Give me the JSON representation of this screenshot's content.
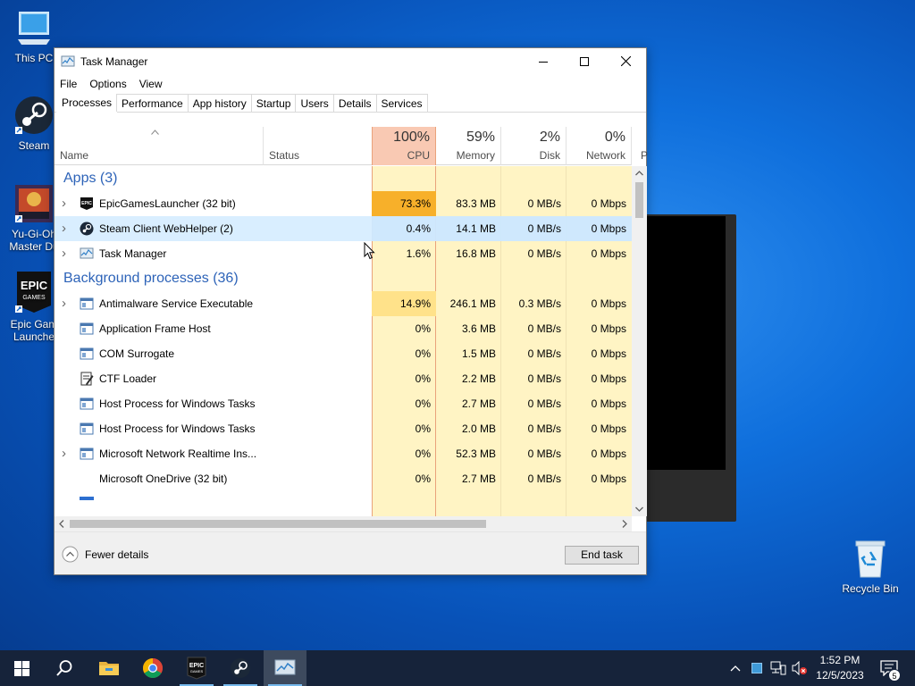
{
  "desktop": {
    "icons": [
      {
        "id": "this-pc",
        "label_lines": [
          "This PC"
        ]
      },
      {
        "id": "steam",
        "label_lines": [
          "Steam"
        ]
      },
      {
        "id": "yugioh",
        "label_lines": [
          "Yu-Gi-Oh",
          "Master Du"
        ]
      },
      {
        "id": "epic",
        "label_lines": [
          "Epic Gam",
          "Launche"
        ]
      },
      {
        "id": "recycle",
        "label_lines": [
          "Recycle Bin"
        ]
      }
    ]
  },
  "window": {
    "title": "Task Manager",
    "menu": [
      "File",
      "Options",
      "View"
    ],
    "tabs": [
      "Processes",
      "Performance",
      "App history",
      "Startup",
      "Users",
      "Details",
      "Services"
    ],
    "active_tab": "Processes",
    "columns": {
      "name": "Name",
      "status": "Status",
      "cpu": {
        "pct": "100%",
        "label": "CPU"
      },
      "memory": {
        "pct": "59%",
        "label": "Memory"
      },
      "disk": {
        "pct": "2%",
        "label": "Disk"
      },
      "network": {
        "pct": "0%",
        "label": "Network"
      },
      "power_partial": "P"
    },
    "groups": {
      "apps": "Apps (3)",
      "background": "Background processes (36)"
    },
    "rows": [
      {
        "group": "apps",
        "name": "EpicGamesLauncher (32 bit)",
        "icon": "epic-games-icon",
        "expandable": true,
        "cpu": "73.3%",
        "memory": "83.3 MB",
        "disk": "0 MB/s",
        "network": "0 Mbps",
        "cpu_heat": "high"
      },
      {
        "group": "apps",
        "name": "Steam Client WebHelper (2)",
        "icon": "steam-icon",
        "expandable": true,
        "cpu": "0.4%",
        "memory": "14.1 MB",
        "disk": "0 MB/s",
        "network": "0 Mbps",
        "selected": true
      },
      {
        "group": "apps",
        "name": "Task Manager",
        "icon": "task-manager-icon",
        "expandable": true,
        "cpu": "1.6%",
        "memory": "16.8 MB",
        "disk": "0 MB/s",
        "network": "0 Mbps"
      },
      {
        "group": "background",
        "name": "Antimalware Service Executable",
        "icon": "service-window-icon",
        "expandable": true,
        "cpu": "14.9%",
        "memory": "246.1 MB",
        "disk": "0.3 MB/s",
        "network": "0 Mbps",
        "cpu_heat": "med"
      },
      {
        "group": "background",
        "name": "Application Frame Host",
        "icon": "service-window-icon",
        "expandable": false,
        "cpu": "0%",
        "memory": "3.6 MB",
        "disk": "0 MB/s",
        "network": "0 Mbps"
      },
      {
        "group": "background",
        "name": "COM Surrogate",
        "icon": "service-window-icon",
        "expandable": false,
        "cpu": "0%",
        "memory": "1.5 MB",
        "disk": "0 MB/s",
        "network": "0 Mbps"
      },
      {
        "group": "background",
        "name": "CTF Loader",
        "icon": "ctf-loader-icon",
        "expandable": false,
        "cpu": "0%",
        "memory": "2.2 MB",
        "disk": "0 MB/s",
        "network": "0 Mbps"
      },
      {
        "group": "background",
        "name": "Host Process for Windows Tasks",
        "icon": "service-window-icon",
        "expandable": false,
        "cpu": "0%",
        "memory": "2.7 MB",
        "disk": "0 MB/s",
        "network": "0 Mbps"
      },
      {
        "group": "background",
        "name": "Host Process for Windows Tasks",
        "icon": "service-window-icon",
        "expandable": false,
        "cpu": "0%",
        "memory": "2.0 MB",
        "disk": "0 MB/s",
        "network": "0 Mbps"
      },
      {
        "group": "background",
        "name": "Microsoft Network Realtime Ins...",
        "icon": "service-window-icon",
        "expandable": true,
        "cpu": "0%",
        "memory": "52.3 MB",
        "disk": "0 MB/s",
        "network": "0 Mbps"
      },
      {
        "group": "background",
        "name": "Microsoft OneDrive (32 bit)",
        "icon": "",
        "expandable": false,
        "cpu": "0%",
        "memory": "2.7 MB",
        "disk": "0 MB/s",
        "network": "0 Mbps"
      }
    ],
    "footer": {
      "fewer_details": "Fewer details",
      "end_task": "End task"
    }
  },
  "taskbar": {
    "apps": [
      "start",
      "search",
      "file-explorer",
      "chrome",
      "epic-games",
      "steam",
      "task-manager"
    ],
    "active_app": "task-manager",
    "clock": {
      "time": "1:52 PM",
      "date": "12/5/2023"
    },
    "notification_count": "5"
  },
  "colors": {
    "accent": "#0078d7",
    "group_header": "#2d63b8",
    "cpu_col": "#fff4c4",
    "cpu_high": "#f7b02a",
    "cpu_med": "#ffe28a",
    "sel": "#cce8ff",
    "taskbar": "#16233a"
  }
}
